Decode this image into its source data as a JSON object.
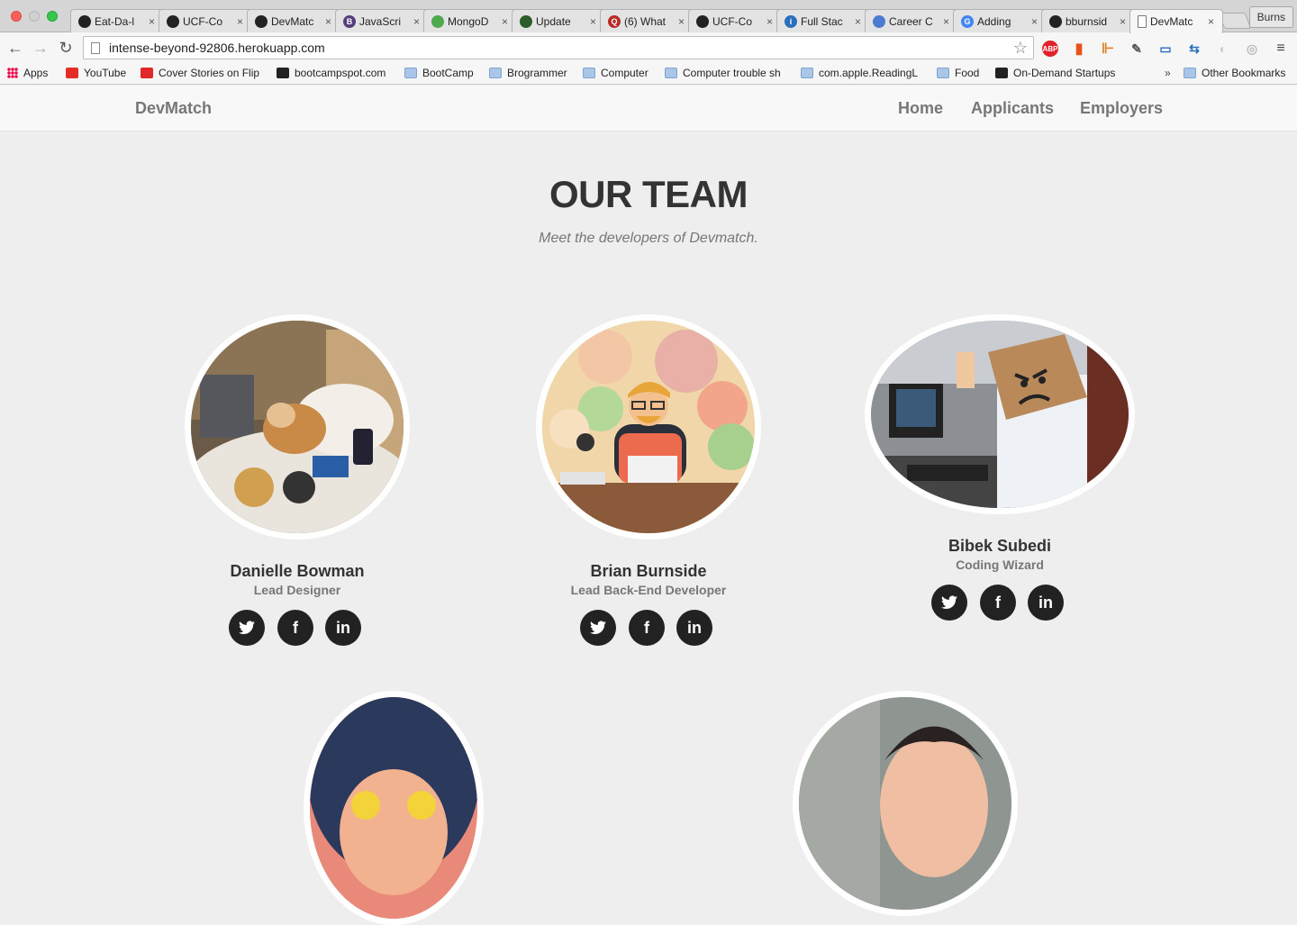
{
  "browser": {
    "tabs": [
      {
        "label": "Eat-Da-l",
        "icon": "github-icon",
        "color": "#222222"
      },
      {
        "label": "UCF-Co",
        "icon": "github-icon",
        "color": "#222222"
      },
      {
        "label": "DevMatc",
        "icon": "github-icon",
        "color": "#222222"
      },
      {
        "label": "JavaScri",
        "icon": "bootstrap-icon",
        "color": "#563d7c",
        "glyph": "B"
      },
      {
        "label": "MongoD",
        "icon": "mongodb-leaf-icon",
        "color": "#4fa94d"
      },
      {
        "label": "Update",
        "icon": "leaf-icon",
        "color": "#2b5d2b"
      },
      {
        "label": "(6) What",
        "icon": "quora-icon",
        "color": "#b92b27",
        "glyph": "Q"
      },
      {
        "label": "UCF-Co",
        "icon": "github-icon",
        "color": "#222222"
      },
      {
        "label": "Full Stac",
        "icon": "info-icon",
        "color": "#2a6fbb",
        "glyph": "i"
      },
      {
        "label": "Career C",
        "icon": "career-icon",
        "color": "#4a7ccf"
      },
      {
        "label": "Adding",
        "icon": "google-icon",
        "color": "#4285f4",
        "glyph": "G"
      },
      {
        "label": "bburnsid",
        "icon": "github-icon",
        "color": "#222222"
      },
      {
        "label": "DevMatc",
        "icon": "page-icon",
        "color": "#ffffff",
        "active": true
      }
    ],
    "profile_label": "Burns",
    "url": "intense-beyond-92806.herokuapp.com",
    "bookmarks": [
      {
        "label": "Apps",
        "icon": "apps-icon"
      },
      {
        "label": "YouTube",
        "icon": "youtube-icon",
        "color": "#e52d27"
      },
      {
        "label": "Cover Stories on Flip",
        "icon": "flipboard-icon",
        "color": "#e12828"
      },
      {
        "label": "bootcampspot.com",
        "icon": "bootcamp-icon",
        "color": "#222222"
      },
      {
        "label": "BootCamp",
        "icon": "folder-icon"
      },
      {
        "label": "Brogrammer",
        "icon": "folder-icon"
      },
      {
        "label": "Computer",
        "icon": "folder-icon"
      },
      {
        "label": "Computer trouble sh",
        "icon": "folder-icon"
      },
      {
        "label": "com.apple.ReadingL",
        "icon": "folder-icon"
      },
      {
        "label": "Food",
        "icon": "folder-icon"
      },
      {
        "label": "On-Demand Startups",
        "icon": "startup-icon",
        "color": "#222222"
      }
    ],
    "overflow_label": "»",
    "other_bookmarks_label": "Other Bookmarks"
  },
  "site": {
    "brand": "DevMatch",
    "nav": [
      "Home",
      "Applicants",
      "Employers"
    ]
  },
  "team": {
    "title": "OUR TEAM",
    "subtitle": "Meet the developers of Devmatch.",
    "members": [
      {
        "name": "Danielle Bowman",
        "role": "Lead Designer",
        "photo": "corgi-in-bed-photo"
      },
      {
        "name": "Brian Burnside",
        "role": "Lead Back-End Developer",
        "photo": "cartoon-developer-illustration"
      },
      {
        "name": "Bibek Subedi",
        "role": "Coding Wizard",
        "photo": "angry-box-head-photo"
      },
      {
        "name": "",
        "role": "",
        "photo": "person-with-yellow-glasses-photo"
      },
      {
        "name": "",
        "role": "",
        "photo": "smiling-man-photo"
      }
    ],
    "social": {
      "twitter": "twitter-icon",
      "facebook": "facebook-icon",
      "linkedin": "linkedin-icon",
      "facebook_glyph": "f",
      "linkedin_glyph": "in"
    }
  },
  "colors": {
    "page_bg": "#eeeeee",
    "navbar_bg": "#f8f8f8",
    "social_bg": "#222222",
    "heading": "#333333",
    "muted": "#777777"
  }
}
